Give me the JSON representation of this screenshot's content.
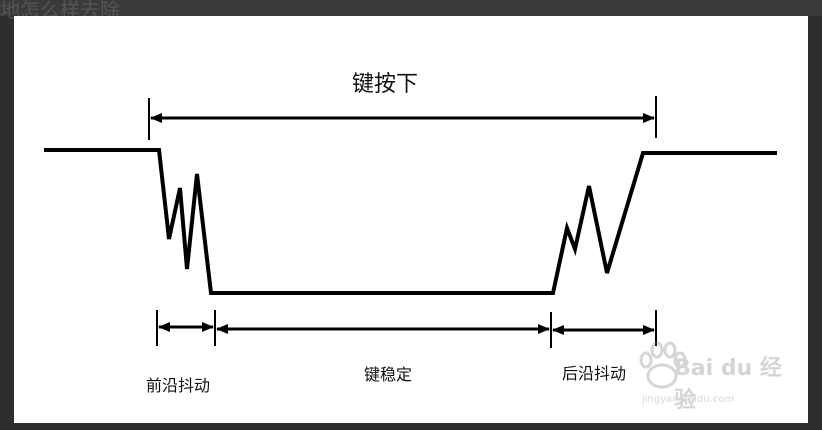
{
  "header": {
    "background_text": "地怎么样去除"
  },
  "diagram": {
    "label_key_pressed": "键按下",
    "label_front_bounce": "前沿抖动",
    "label_key_stable": "键稳定",
    "label_back_bounce": "后沿抖动"
  },
  "watermark": {
    "brand": "Bai du 经验",
    "url": "jingyan.baidu.com"
  },
  "colors": {
    "line": "#000000",
    "canvas": "#ffffff",
    "frame": "#2e2e2e"
  }
}
